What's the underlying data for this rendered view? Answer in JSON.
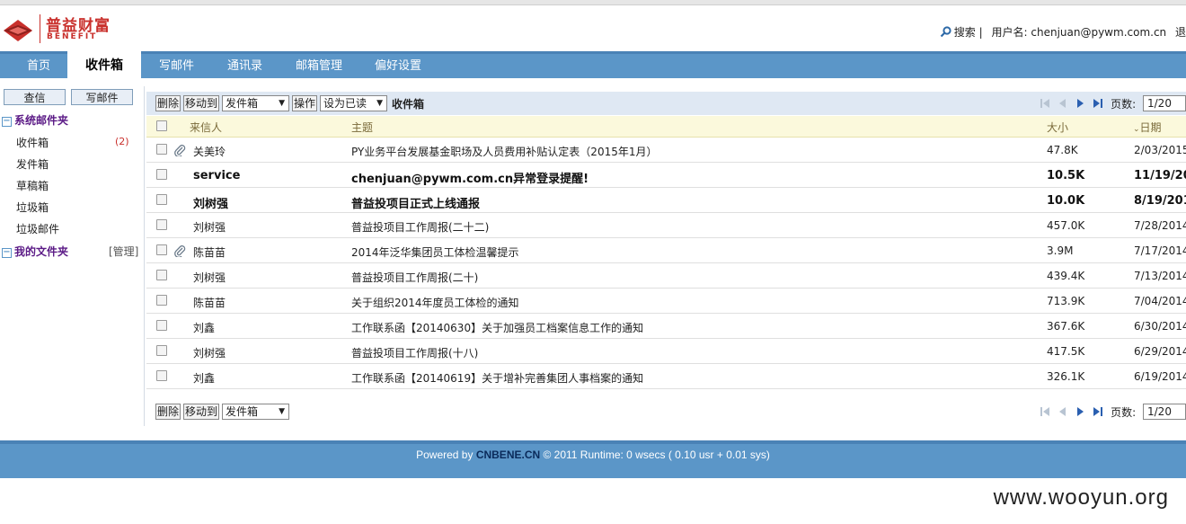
{
  "header": {
    "logo_cn": "普益财富",
    "logo_en": "BENEFIT",
    "search_label": "搜索",
    "separator": "|",
    "username_label": "用户名:",
    "username": "chenjuan@pywm.com.cn",
    "trailing_char": "退"
  },
  "nav": {
    "items": [
      {
        "label": "首页"
      },
      {
        "label": "收件箱"
      },
      {
        "label": "写邮件"
      },
      {
        "label": "通讯录"
      },
      {
        "label": "邮箱管理"
      },
      {
        "label": "偏好设置"
      }
    ],
    "active_index": 1
  },
  "sidebar": {
    "buttons": {
      "check": "查信",
      "compose": "写邮件"
    },
    "system_folders_title": "系统邮件夹",
    "folders": [
      {
        "label": "收件箱",
        "count": "(2)"
      },
      {
        "label": "发件箱"
      },
      {
        "label": "草稿箱"
      },
      {
        "label": "垃圾箱"
      },
      {
        "label": "垃圾邮件"
      }
    ],
    "my_folders_title": "我的文件夹",
    "manage_label": "[管理]"
  },
  "toolbar": {
    "delete": "删除",
    "move_to": "移动到",
    "folder_select": "发件箱",
    "action": "操作",
    "mark_select": "设为已读",
    "current_folder": "收件箱",
    "page_label": "页数:",
    "page_value": "1/20"
  },
  "table": {
    "headers": {
      "from": "来信人",
      "subject": "主题",
      "size": "大小",
      "date": "日期"
    },
    "rows": [
      {
        "from": "关美玲",
        "subject": "PY业务平台发展基金职场及人员费用补贴认定表（2015年1月）",
        "size": "47.8K",
        "date": "2/03/2015",
        "unread": false,
        "attachment": true
      },
      {
        "from": "service",
        "subject": "chenjuan@pywm.com.cn异常登录提醒!",
        "size": "10.5K",
        "date": "11/19/20",
        "unread": true,
        "attachment": false
      },
      {
        "from": "刘树强",
        "subject": "普益投项目正式上线通报",
        "size": "10.0K",
        "date": "8/19/201",
        "unread": true,
        "attachment": false
      },
      {
        "from": "刘树强",
        "subject": "普益投项目工作周报(二十二)",
        "size": "457.0K",
        "date": "7/28/2014",
        "unread": false,
        "attachment": false
      },
      {
        "from": "陈苗苗",
        "subject": "2014年泛华集团员工体检温馨提示",
        "size": "3.9M",
        "date": "7/17/2014",
        "unread": false,
        "attachment": true
      },
      {
        "from": "刘树强",
        "subject": "普益投项目工作周报(二十)",
        "size": "439.4K",
        "date": "7/13/2014",
        "unread": false,
        "attachment": false
      },
      {
        "from": "陈苗苗",
        "subject": "关于组织2014年度员工体检的通知",
        "size": "713.9K",
        "date": "7/04/2014",
        "unread": false,
        "attachment": false
      },
      {
        "from": "刘鑫",
        "subject": "工作联系函【20140630】关于加强员工档案信息工作的通知",
        "size": "367.6K",
        "date": "6/30/2014",
        "unread": false,
        "attachment": false
      },
      {
        "from": "刘树强",
        "subject": "普益投项目工作周报(十八)",
        "size": "417.5K",
        "date": "6/29/2014",
        "unread": false,
        "attachment": false
      },
      {
        "from": "刘鑫",
        "subject": "工作联系函【20140619】关于增补完善集团人事档案的通知",
        "size": "326.1K",
        "date": "6/19/2014",
        "unread": false,
        "attachment": false
      }
    ]
  },
  "footer": {
    "powered_by": "Powered by ",
    "brand": "CNBENE.CN",
    "rest": " © 2011 Runtime: 0 wsecs ( 0.10 usr + 0.01 sys)"
  },
  "watermark": "www.wooyun.org",
  "colors": {
    "nav_bg": "#5b96c8",
    "brand_red": "#c9302c",
    "folder_title": "#5b1a86"
  }
}
